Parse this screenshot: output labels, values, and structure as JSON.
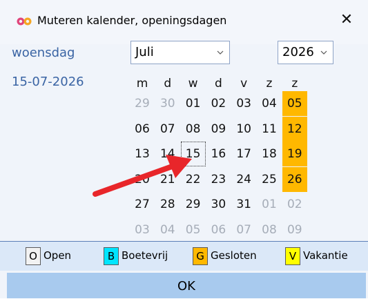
{
  "window": {
    "title": "Muteren kalender, openingsdagen",
    "close_label": "✕"
  },
  "selected": {
    "weekday": "woensdag",
    "date": "15-07-2026"
  },
  "month": {
    "value": "Juli"
  },
  "year": {
    "value": "2026"
  },
  "calendar": {
    "headers": [
      "m",
      "d",
      "w",
      "d",
      "v",
      "z",
      "z"
    ],
    "weeks": [
      [
        {
          "d": "29",
          "dim": true
        },
        {
          "d": "30",
          "dim": true
        },
        {
          "d": "01"
        },
        {
          "d": "02"
        },
        {
          "d": "03"
        },
        {
          "d": "04"
        },
        {
          "d": "05",
          "weekend": true
        }
      ],
      [
        {
          "d": "06"
        },
        {
          "d": "07"
        },
        {
          "d": "08"
        },
        {
          "d": "09"
        },
        {
          "d": "10"
        },
        {
          "d": "11"
        },
        {
          "d": "12",
          "weekend": true
        }
      ],
      [
        {
          "d": "13"
        },
        {
          "d": "14"
        },
        {
          "d": "15",
          "today": true
        },
        {
          "d": "16"
        },
        {
          "d": "17"
        },
        {
          "d": "18"
        },
        {
          "d": "19",
          "weekend": true
        }
      ],
      [
        {
          "d": "20"
        },
        {
          "d": "21"
        },
        {
          "d": "22"
        },
        {
          "d": "23"
        },
        {
          "d": "24"
        },
        {
          "d": "25"
        },
        {
          "d": "26",
          "weekend": true
        }
      ],
      [
        {
          "d": "27"
        },
        {
          "d": "28"
        },
        {
          "d": "29"
        },
        {
          "d": "30"
        },
        {
          "d": "31"
        },
        {
          "d": "01",
          "dim": true
        },
        {
          "d": "02",
          "dim": true
        }
      ],
      [
        {
          "d": "03",
          "dim": true
        },
        {
          "d": "04",
          "dim": true
        },
        {
          "d": "05",
          "dim": true
        },
        {
          "d": "06",
          "dim": true
        },
        {
          "d": "07",
          "dim": true
        },
        {
          "d": "08",
          "dim": true
        },
        {
          "d": "09",
          "dim": true
        }
      ]
    ]
  },
  "legend": [
    {
      "key": "O",
      "label": "Open",
      "color": "#f2f2f2"
    },
    {
      "key": "B",
      "label": "Boetevrij",
      "color": "#00e5ff"
    },
    {
      "key": "G",
      "label": "Gesloten",
      "color": "#ffb800"
    },
    {
      "key": "V",
      "label": "Vakantie",
      "color": "#ffff00"
    }
  ],
  "ok_label": "OK",
  "colors": {
    "accent_text": "#3a64a4",
    "weekend": "#ffb800",
    "annotation_arrow": "#e8262a"
  }
}
